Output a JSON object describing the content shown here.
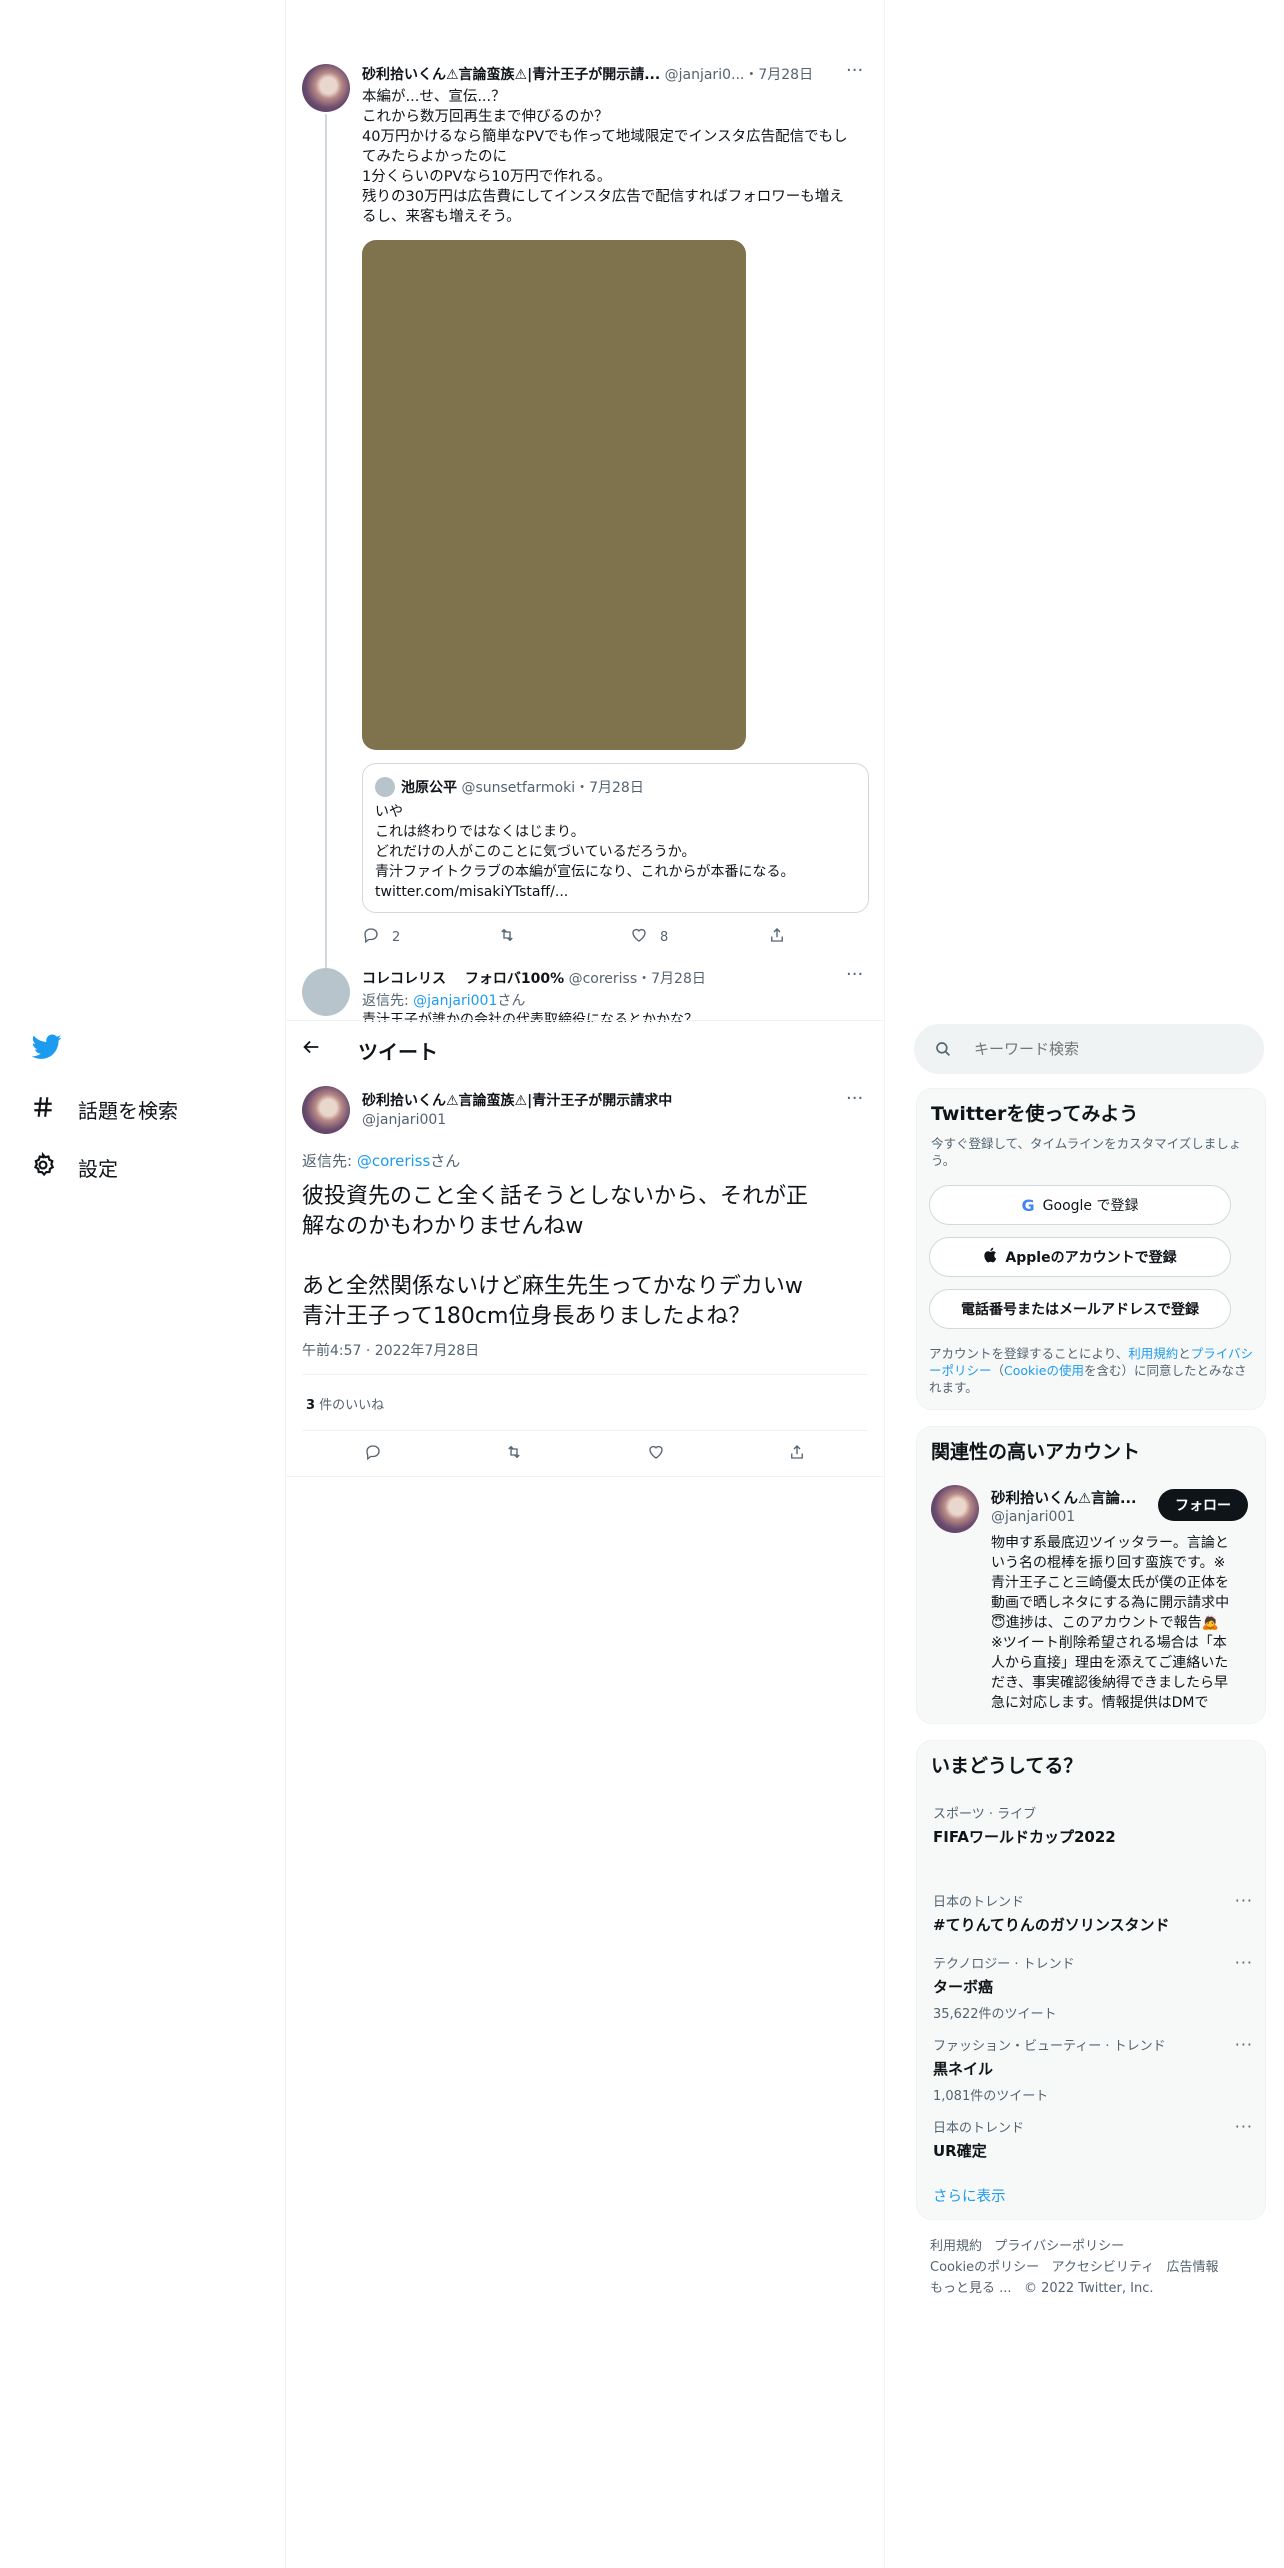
{
  "colors": {
    "brand": "#1d9bf0",
    "text": "#0f1419",
    "muted": "#536471",
    "media": "#7f734e"
  },
  "nav": {
    "logo": "twitter-bird-icon",
    "items": [
      {
        "label": "話題を検索",
        "icon": "hashtag-icon"
      },
      {
        "label": "設定",
        "icon": "gear-icon"
      }
    ]
  },
  "thread_tweet": {
    "author_name": "砂利拾いくん⚠言論蛮族⚠|青汁王子が開示請...",
    "handle": "@janjari0...",
    "date": "・7月28日",
    "lines": [
      "本編が...せ、宣伝...？",
      "これから数万回再生まで伸びるのか？",
      "40万円かけるなら簡単なPVでも作って地域限定でインスタ広告配信でもし",
      "てみたらよかったのに",
      "1分くらいのPVなら10万円で作れる。",
      "残りの30万円は広告費にしてインスタ広告で配信すればフォロワーも増え",
      "るし、来客も増えそう。"
    ],
    "quote": {
      "name": "池原公平",
      "handle": "@sunsetfarmoki",
      "date": "・7月28日",
      "lines": [
        "いや",
        "これは終わりではなくはじまり。",
        "どれだけの人がこのことに気づいているだろうか。",
        "青汁ファイトクラブの本編が宣伝になり、これからが本番になる。",
        "twitter.com/misakiYTstaff/..."
      ]
    },
    "reply_count": "2",
    "like_count": "8"
  },
  "reply_preview": {
    "name": "コレコレリス　 フォロバ100%",
    "handle": "@coreriss",
    "date": "・7月28日",
    "reply_prefix": "返信先: ",
    "reply_to": "@janjari001",
    "reply_suffix": "さん",
    "partial_text": "青汁王子が誰かの会社の代表取締役になるとかかな？"
  },
  "header": {
    "back_icon": "back-arrow-icon",
    "title": "ツイート"
  },
  "main_tweet": {
    "author_name": "砂利拾いくん⚠言論蛮族⚠|青汁王子が開示請求中",
    "handle": "@janjari001",
    "reply_prefix": "返信先: ",
    "reply_to": "@coreriss",
    "reply_suffix": "さん",
    "text_lines": [
      "彼投資先のこと全く話そうとしないから、それが正",
      "解なのかもわかりませんねw",
      "",
      "あと全然関係ないけど麻生先生ってかなりデカいw",
      "青汁王子って180cm位身長ありましたよね？"
    ],
    "timestamp": "午前4:57 · 2022年7月28日",
    "likes_number": "3",
    "likes_label": " 件のいいね"
  },
  "search": {
    "placeholder": "キーワード検索"
  },
  "signup": {
    "title": "Twitterを使ってみよう",
    "subtitle": "今すぐ登録して、タイムラインをカスタマイズしましょう。",
    "google_label": "Google で登録",
    "apple_label": "Appleのアカウントで登録",
    "phone_label": "電話番号またはメールアドレスで登録",
    "legal_1": "アカウントを登録することにより、",
    "legal_terms": "利用規約",
    "legal_2": "と",
    "legal_privacy": "プライバシーポリシー",
    "legal_3": "（",
    "legal_cookie": "Cookieの使用",
    "legal_4": "を含む）に同意したとみなされます。"
  },
  "related": {
    "title": "関連性の高いアカウント",
    "name": "砂利拾いくん⚠言論...",
    "handle": "@janjari001",
    "follow_label": "フォロー",
    "bio_lines": [
      "物申す系最底辺ツイッタラー。言論と",
      "いう名の棍棒を振り回す蛮族です。※",
      "青汁王子こと三崎優太氏が僕の正体を",
      "動画で晒しネタにする為に開示請求中",
      "😇進捗は、このアカウントで報告🙇",
      "※ツイート削除希望される場合は「本",
      "人から直接」理由を添えてご連絡いた",
      "だき、事実確認後納得できましたら早",
      "急に対応します。情報提供はDMで"
    ]
  },
  "trends": {
    "title": "いまどうしてる？",
    "items": [
      {
        "category": "スポーツ · ライブ",
        "name": "FIFAワールドカップ2022",
        "count": ""
      },
      {
        "category": "日本のトレンド",
        "name": "#てりんてりんのガソリンスタンド",
        "count": ""
      },
      {
        "category": "テクノロジー · トレンド",
        "name": "ターボ癌",
        "count": "35,622件のツイート"
      },
      {
        "category": "ファッション・ビューティー · トレンド",
        "name": "黒ネイル",
        "count": "1,081件のツイート"
      },
      {
        "category": "日本のトレンド",
        "name": "UR確定",
        "count": ""
      }
    ],
    "more_label": "さらに表示"
  },
  "footer": {
    "links_row1": [
      "利用規約",
      "プライバシーポリシー"
    ],
    "links_row2": [
      "Cookieのポリシー",
      "アクセシビリティ",
      "広告情報"
    ],
    "more_label": "もっと見る ...",
    "copyright": "© 2022 Twitter, Inc."
  }
}
